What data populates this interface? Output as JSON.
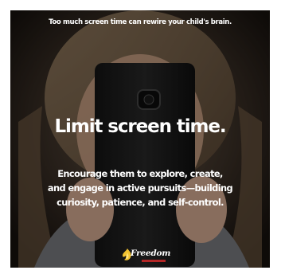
{
  "tagline": "Too much screen time can rewire your child's brain.",
  "headline": "Limit screen time.",
  "body_lines": [
    "Encourage them to explore, create,",
    "and engage in active pursuits—building",
    "curiosity, patience, and self-control."
  ],
  "logo": {
    "name": "Freedom",
    "icon": "freedom-flame-logo-icon"
  },
  "colors": {
    "text": "#ffffff",
    "background": "#1e1914",
    "logo_accent": "#f2c230"
  }
}
